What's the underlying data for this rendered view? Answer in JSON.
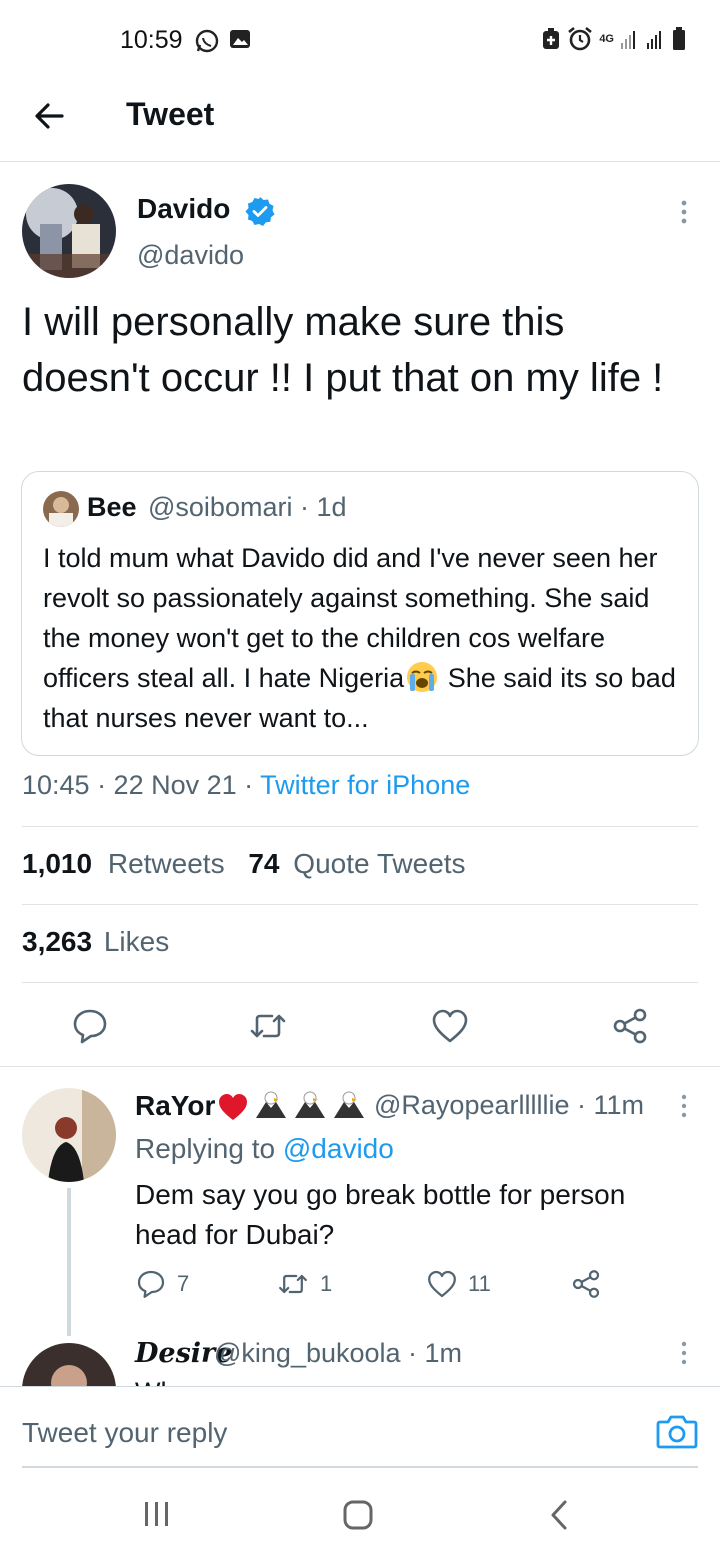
{
  "status_bar": {
    "time": "10:59",
    "network": "4G",
    "icons": [
      "whatsapp-icon",
      "gallery-icon",
      "battery-saver-icon",
      "alarm-icon",
      "signal-icon",
      "battery-icon"
    ]
  },
  "header": {
    "title": "Tweet",
    "back_icon": "arrow-left-icon"
  },
  "tweet": {
    "author_name": "Davido",
    "author_handle": "@davido",
    "verified": true,
    "text": "I will personally make sure this doesn't occur !! I put that on my life !",
    "time": "10:45 · 22 Nov 21 · ",
    "source": "Twitter for iPhone",
    "quote": {
      "author_name": "Bee",
      "author_meta": "@soibomari · 1d",
      "text_before_emoji": "I told mum what Davido did and I've never seen her revolt so passionately against something. She said the money won't get to the children cos welfare officers steal all. I hate Nigeria",
      "text_after_emoji": " She said its so bad that nurses never want to..."
    },
    "stats": {
      "retweets": "1,010",
      "retweets_label": "Retweets",
      "quote_tweets": "74",
      "quote_tweets_label": "Quote Tweets",
      "likes": "3,263",
      "likes_label": "Likes"
    }
  },
  "replies": [
    {
      "author_name": "RaYor",
      "author_meta": "@Rayopearlllllie · 11m",
      "replying_prefix": "Replying to ",
      "replying_to": "@davido",
      "text": "Dem say you go break bottle for person head for Dubai?",
      "reply_count": "7",
      "retweet_count": "1",
      "like_count": "11"
    },
    {
      "author_name": "Desire",
      "author_meta": "@king_bukoola · 1m",
      "text_peek": "Wh"
    }
  ],
  "composer": {
    "placeholder": "Tweet your reply"
  },
  "colors": {
    "accent": "#1d9bf0",
    "secondary_text": "#536471",
    "divider": "#e1e4e6",
    "heart": "#e0162b"
  }
}
